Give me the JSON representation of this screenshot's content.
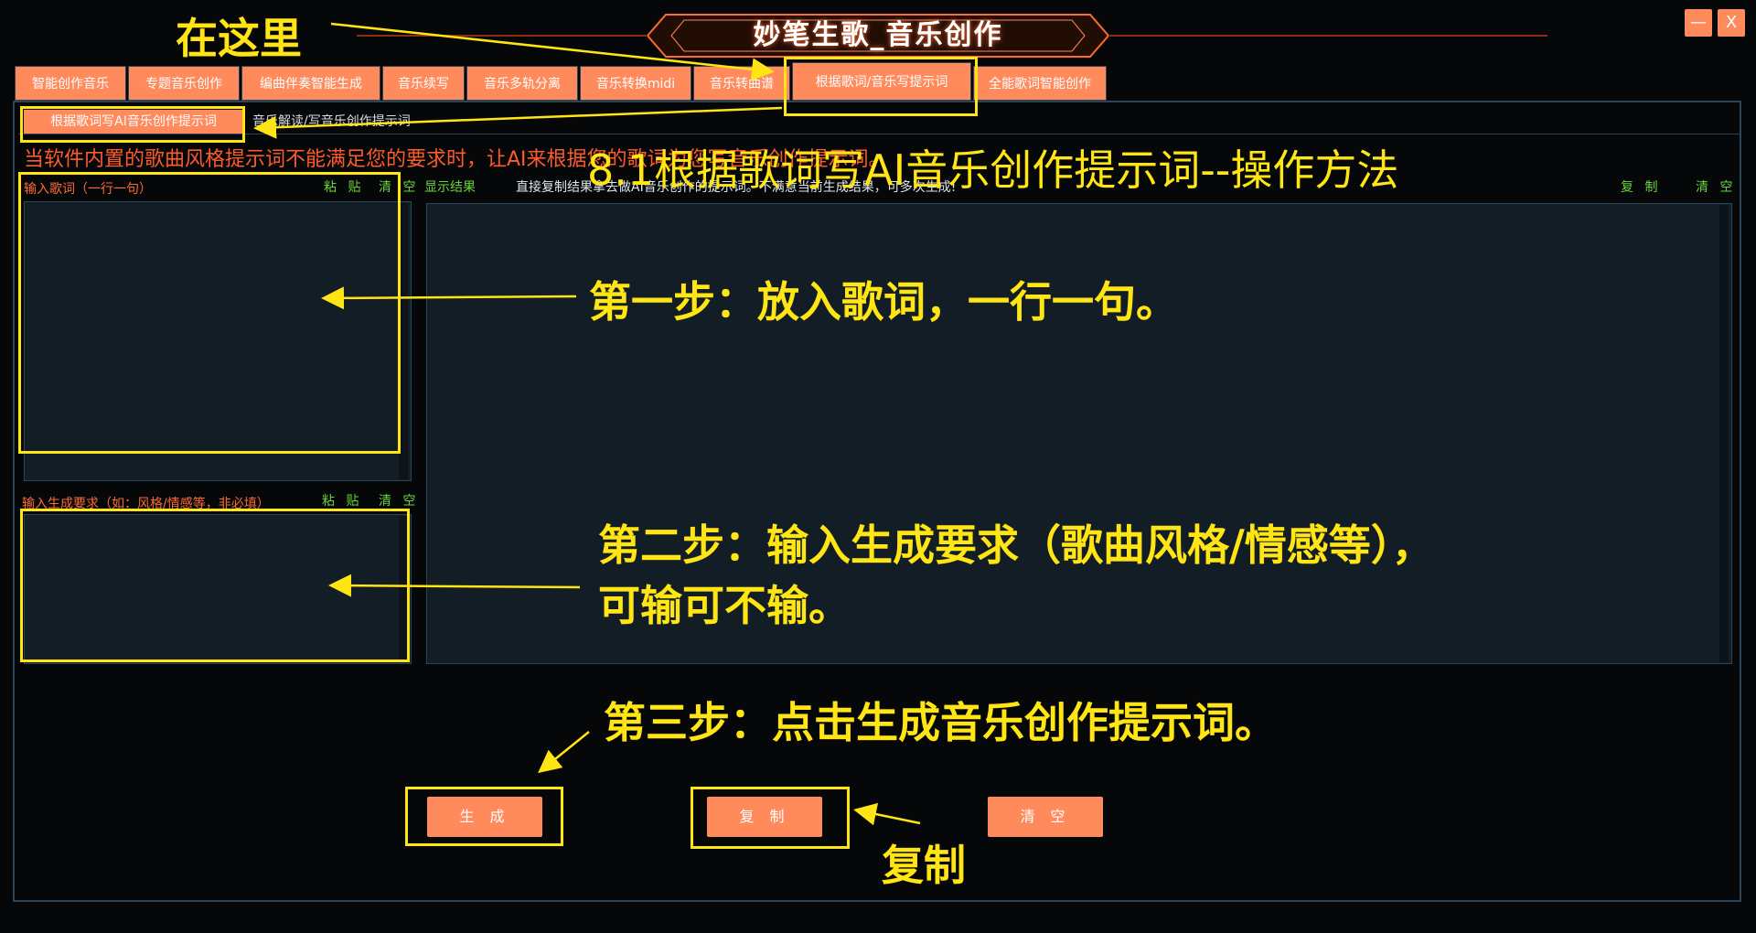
{
  "app": {
    "title": "妙笔生歌_音乐创作",
    "minimize": "—",
    "close": "X"
  },
  "tabs": [
    "智能创作音乐",
    "专题音乐创作",
    "编曲伴奏智能生成",
    "音乐续写",
    "音乐多轨分离",
    "音乐转换midi",
    "音乐转曲谱",
    "根据歌词/音乐写提示词",
    "全能歌词智能创作"
  ],
  "subtabs": {
    "active": "根据歌词写AI音乐创作提示词",
    "other": "音乐解读/写音乐创作提示词"
  },
  "banner": "当软件内置的歌曲风格提示词不能满足您的要求时，让AI来根据您的歌词为您写音乐创作提示词。",
  "lyrics": {
    "label": "输入歌词（一行一句）",
    "paste": "粘 贴",
    "clear": "清 空"
  },
  "requirement": {
    "label": "输入生成要求（如：风格/情感等，非必填）",
    "paste": "粘 贴",
    "clear": "清 空"
  },
  "result": {
    "label": "显示结果",
    "hint": "直接复制结果拿去做AI音乐创作的提示词。不满意当前生成结果，可多次生成!",
    "copy": "复 制",
    "clear": "清 空"
  },
  "buttons": {
    "generate": "生 成",
    "copy": "复 制",
    "clear": "清 空"
  },
  "annotations": {
    "here": "在这里",
    "heading": "8.1根据歌词写AI音乐创作提示词--操作方法",
    "step1": "第一步：放入歌词，一行一句。",
    "step2_line1": "第二步：输入生成要求（歌曲风格/情感等），",
    "step2_line2": "可输可不输。",
    "step3": "第三步：点击生成音乐创作提示词。",
    "copy_note": "复制"
  },
  "colors": {
    "accent": "#ff8a5c",
    "annotation": "#ffe514",
    "warning": "#ff5a2a",
    "positive": "#6bd43a"
  }
}
